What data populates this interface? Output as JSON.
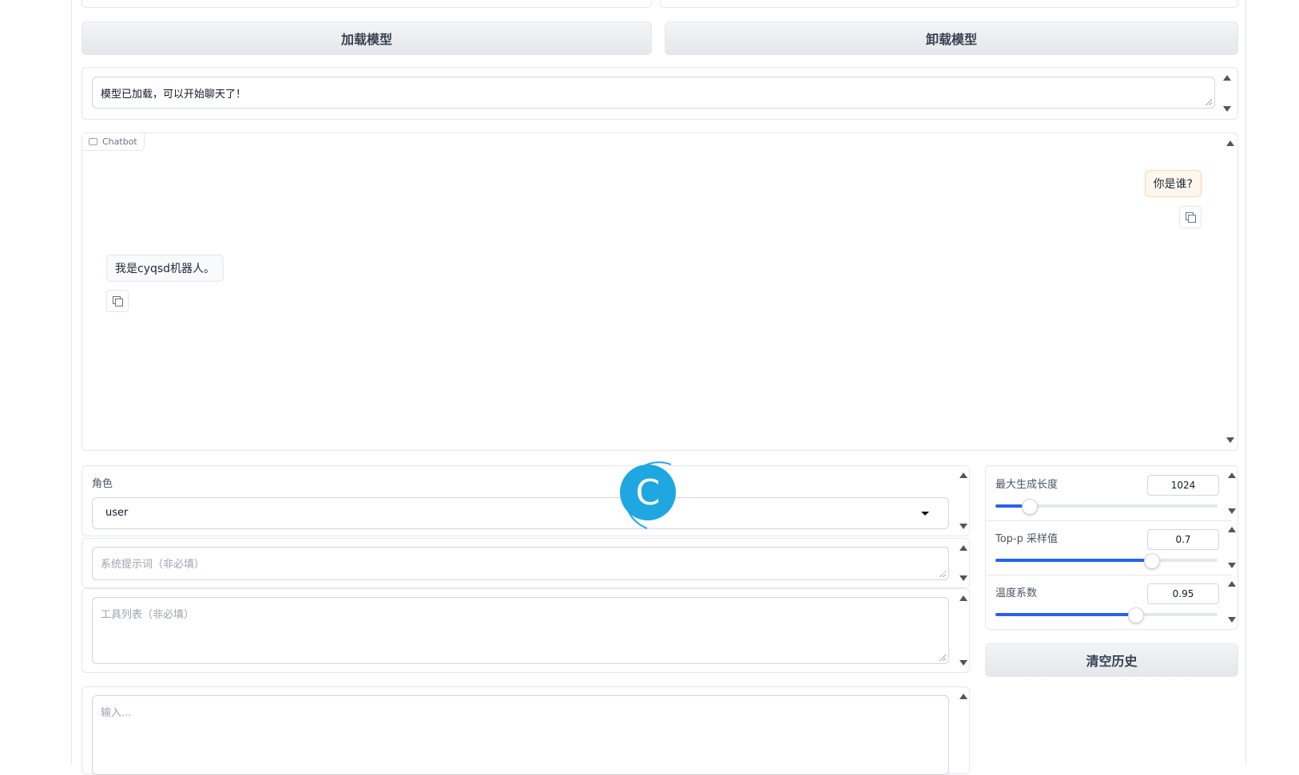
{
  "buttons": {
    "load_model": "加载模型",
    "unload_model": "卸载模型",
    "clear_history": "清空历史"
  },
  "status": {
    "message": "模型已加载，可以开始聊天了！"
  },
  "chatbot": {
    "label": "Chatbot",
    "messages": [
      {
        "role": "user",
        "text": "你是谁?"
      },
      {
        "role": "bot",
        "text": "我是cyqsd机器人。"
      }
    ]
  },
  "role": {
    "label": "角色",
    "selected": "user"
  },
  "system_prompt": {
    "placeholder": "系统提示词（非必填）"
  },
  "tools": {
    "placeholder": "工具列表（非必填）"
  },
  "input": {
    "placeholder": "输入..."
  },
  "sliders": {
    "max_length": {
      "label": "最大生成长度",
      "value": "1024",
      "fraction": 0.15
    },
    "top_p": {
      "label": "Top-p 采样值",
      "value": "0.7",
      "fraction": 0.7
    },
    "temperature": {
      "label": "温度系数",
      "value": "0.95",
      "fraction": 0.63
    }
  },
  "overlay": {
    "logo_letter": "C",
    "logo_color": "#1ea7e1"
  },
  "colors": {
    "accent": "#2563eb",
    "user_bubble": "#fff7ed",
    "user_bubble_border": "#fcd9a8"
  }
}
